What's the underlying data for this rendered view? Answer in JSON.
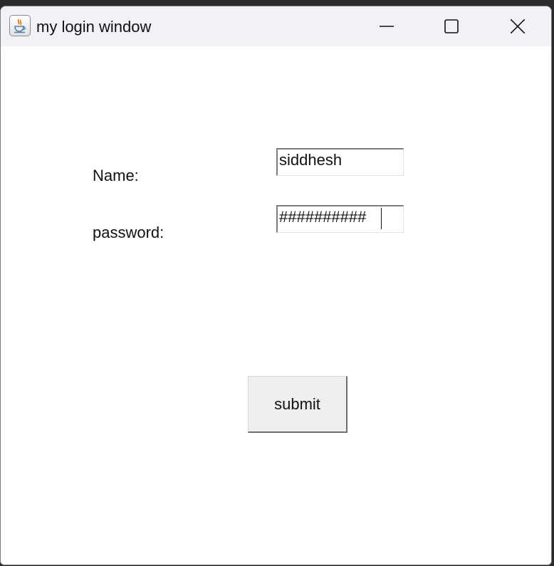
{
  "window": {
    "title": "my login window",
    "icon": "java-coffee-cup-icon",
    "controls": {
      "minimize_icon": "minimize-icon",
      "maximize_icon": "maximize-icon",
      "close_icon": "close-icon"
    }
  },
  "form": {
    "name_label": "Name:",
    "name_value": "siddhesh",
    "password_label": "password:",
    "password_value": "##########",
    "submit_label": "submit"
  },
  "colors": {
    "titlebar": "#f2f1f6",
    "content": "#ffffff",
    "button": "#efefef"
  }
}
